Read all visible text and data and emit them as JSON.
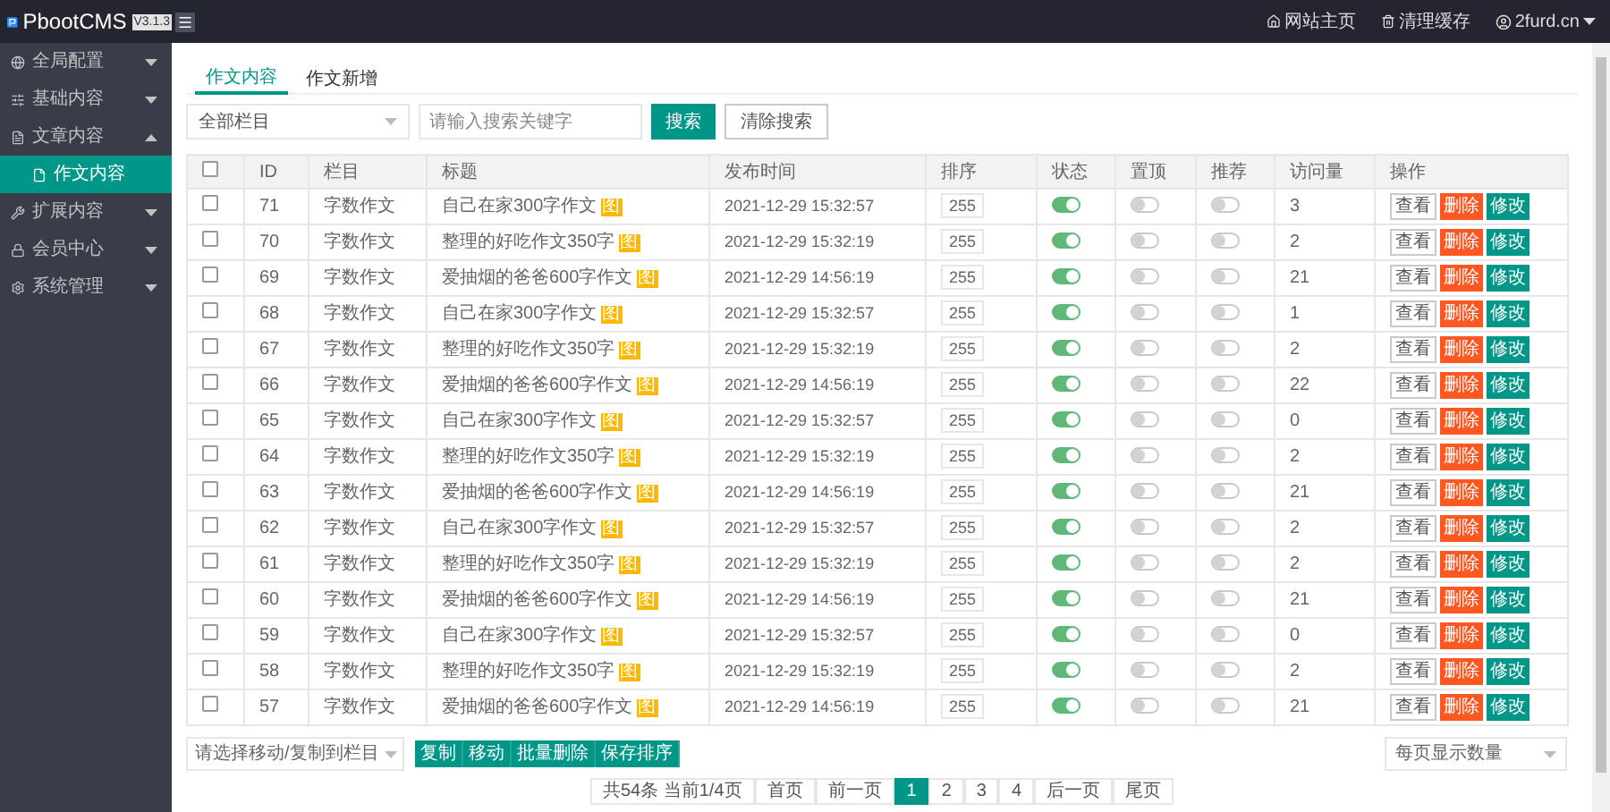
{
  "header": {
    "logo": "PbootCMS",
    "version": "V3.1.3",
    "links": [
      "网站主页",
      "清理缓存"
    ],
    "user": "2furd.cn"
  },
  "sidebar": {
    "items": [
      {
        "label": "全局配置",
        "expanded": false
      },
      {
        "label": "基础内容",
        "expanded": false
      },
      {
        "label": "文章内容",
        "expanded": true,
        "children": [
          {
            "label": "作文内容",
            "selected": true
          }
        ]
      },
      {
        "label": "扩展内容",
        "expanded": false
      },
      {
        "label": "会员中心",
        "expanded": false
      },
      {
        "label": "系统管理",
        "expanded": false
      }
    ]
  },
  "tabs": [
    {
      "label": "作文内容",
      "selected": true
    },
    {
      "label": "作文新增",
      "selected": false
    }
  ],
  "filters": {
    "category": "全部栏目",
    "search_placeholder": "请输入搜索关键字",
    "buttons": [
      {
        "label": "搜索",
        "kind": "primary"
      },
      {
        "label": "清除搜索",
        "kind": "plain"
      }
    ]
  },
  "table": {
    "header_checked": false,
    "columns": [
      "ID",
      "栏目",
      "标题",
      "发布时间",
      "排序",
      "状态",
      "置顶",
      "推荐",
      "访问量",
      "操作"
    ],
    "rows": [
      {
        "checked": false,
        "id": "71",
        "category": "字数作文",
        "title": "自己在家300字作文",
        "badge": "图",
        "time": "2021-12-29 15:32:57",
        "sort": "255",
        "status": true,
        "top": false,
        "recommend": false,
        "visits": "3",
        "actions": [
          {
            "label": "查看",
            "kind": "view"
          },
          {
            "label": "删除",
            "kind": "delete"
          },
          {
            "label": "修改",
            "kind": "edit"
          }
        ]
      },
      {
        "checked": false,
        "id": "70",
        "category": "字数作文",
        "title": "整理的好吃作文350字",
        "badge": "图",
        "time": "2021-12-29 15:32:19",
        "sort": "255",
        "status": true,
        "top": false,
        "recommend": false,
        "visits": "2",
        "actions": [
          {
            "label": "查看",
            "kind": "view"
          },
          {
            "label": "删除",
            "kind": "delete"
          },
          {
            "label": "修改",
            "kind": "edit"
          }
        ]
      },
      {
        "checked": false,
        "id": "69",
        "category": "字数作文",
        "title": "爱抽烟的爸爸600字作文",
        "badge": "图",
        "time": "2021-12-29 14:56:19",
        "sort": "255",
        "status": true,
        "top": false,
        "recommend": false,
        "visits": "21",
        "actions": [
          {
            "label": "查看",
            "kind": "view"
          },
          {
            "label": "删除",
            "kind": "delete"
          },
          {
            "label": "修改",
            "kind": "edit"
          }
        ]
      },
      {
        "checked": false,
        "id": "68",
        "category": "字数作文",
        "title": "自己在家300字作文",
        "badge": "图",
        "time": "2021-12-29 15:32:57",
        "sort": "255",
        "status": true,
        "top": false,
        "recommend": false,
        "visits": "1",
        "actions": [
          {
            "label": "查看",
            "kind": "view"
          },
          {
            "label": "删除",
            "kind": "delete"
          },
          {
            "label": "修改",
            "kind": "edit"
          }
        ]
      },
      {
        "checked": false,
        "id": "67",
        "category": "字数作文",
        "title": "整理的好吃作文350字",
        "badge": "图",
        "time": "2021-12-29 15:32:19",
        "sort": "255",
        "status": true,
        "top": false,
        "recommend": false,
        "visits": "2",
        "actions": [
          {
            "label": "查看",
            "kind": "view"
          },
          {
            "label": "删除",
            "kind": "delete"
          },
          {
            "label": "修改",
            "kind": "edit"
          }
        ]
      },
      {
        "checked": false,
        "id": "66",
        "category": "字数作文",
        "title": "爱抽烟的爸爸600字作文",
        "badge": "图",
        "time": "2021-12-29 14:56:19",
        "sort": "255",
        "status": true,
        "top": false,
        "recommend": false,
        "visits": "22",
        "actions": [
          {
            "label": "查看",
            "kind": "view"
          },
          {
            "label": "删除",
            "kind": "delete"
          },
          {
            "label": "修改",
            "kind": "edit"
          }
        ]
      },
      {
        "checked": false,
        "id": "65",
        "category": "字数作文",
        "title": "自己在家300字作文",
        "badge": "图",
        "time": "2021-12-29 15:32:57",
        "sort": "255",
        "status": true,
        "top": false,
        "recommend": false,
        "visits": "0",
        "actions": [
          {
            "label": "查看",
            "kind": "view"
          },
          {
            "label": "删除",
            "kind": "delete"
          },
          {
            "label": "修改",
            "kind": "edit"
          }
        ]
      },
      {
        "checked": false,
        "id": "64",
        "category": "字数作文",
        "title": "整理的好吃作文350字",
        "badge": "图",
        "time": "2021-12-29 15:32:19",
        "sort": "255",
        "status": true,
        "top": false,
        "recommend": false,
        "visits": "2",
        "actions": [
          {
            "label": "查看",
            "kind": "view"
          },
          {
            "label": "删除",
            "kind": "delete"
          },
          {
            "label": "修改",
            "kind": "edit"
          }
        ]
      },
      {
        "checked": false,
        "id": "63",
        "category": "字数作文",
        "title": "爱抽烟的爸爸600字作文",
        "badge": "图",
        "time": "2021-12-29 14:56:19",
        "sort": "255",
        "status": true,
        "top": false,
        "recommend": false,
        "visits": "21",
        "actions": [
          {
            "label": "查看",
            "kind": "view"
          },
          {
            "label": "删除",
            "kind": "delete"
          },
          {
            "label": "修改",
            "kind": "edit"
          }
        ]
      },
      {
        "checked": false,
        "id": "62",
        "category": "字数作文",
        "title": "自己在家300字作文",
        "badge": "图",
        "time": "2021-12-29 15:32:57",
        "sort": "255",
        "status": true,
        "top": false,
        "recommend": false,
        "visits": "2",
        "actions": [
          {
            "label": "查看",
            "kind": "view"
          },
          {
            "label": "删除",
            "kind": "delete"
          },
          {
            "label": "修改",
            "kind": "edit"
          }
        ]
      },
      {
        "checked": false,
        "id": "61",
        "category": "字数作文",
        "title": "整理的好吃作文350字",
        "badge": "图",
        "time": "2021-12-29 15:32:19",
        "sort": "255",
        "status": true,
        "top": false,
        "recommend": false,
        "visits": "2",
        "actions": [
          {
            "label": "查看",
            "kind": "view"
          },
          {
            "label": "删除",
            "kind": "delete"
          },
          {
            "label": "修改",
            "kind": "edit"
          }
        ]
      },
      {
        "checked": false,
        "id": "60",
        "category": "字数作文",
        "title": "爱抽烟的爸爸600字作文",
        "badge": "图",
        "time": "2021-12-29 14:56:19",
        "sort": "255",
        "status": true,
        "top": false,
        "recommend": false,
        "visits": "21",
        "actions": [
          {
            "label": "查看",
            "kind": "view"
          },
          {
            "label": "删除",
            "kind": "delete"
          },
          {
            "label": "修改",
            "kind": "edit"
          }
        ]
      },
      {
        "checked": false,
        "id": "59",
        "category": "字数作文",
        "title": "自己在家300字作文",
        "badge": "图",
        "time": "2021-12-29 15:32:57",
        "sort": "255",
        "status": true,
        "top": false,
        "recommend": false,
        "visits": "0",
        "actions": [
          {
            "label": "查看",
            "kind": "view"
          },
          {
            "label": "删除",
            "kind": "delete"
          },
          {
            "label": "修改",
            "kind": "edit"
          }
        ]
      },
      {
        "checked": false,
        "id": "58",
        "category": "字数作文",
        "title": "整理的好吃作文350字",
        "badge": "图",
        "time": "2021-12-29 15:32:19",
        "sort": "255",
        "status": true,
        "top": false,
        "recommend": false,
        "visits": "2",
        "actions": [
          {
            "label": "查看",
            "kind": "view"
          },
          {
            "label": "删除",
            "kind": "delete"
          },
          {
            "label": "修改",
            "kind": "edit"
          }
        ]
      },
      {
        "checked": false,
        "id": "57",
        "category": "字数作文",
        "title": "爱抽烟的爸爸600字作文",
        "badge": "图",
        "time": "2021-12-29 14:56:19",
        "sort": "255",
        "status": true,
        "top": false,
        "recommend": false,
        "visits": "21",
        "actions": [
          {
            "label": "查看",
            "kind": "view"
          },
          {
            "label": "删除",
            "kind": "delete"
          },
          {
            "label": "修改",
            "kind": "edit"
          }
        ]
      }
    ]
  },
  "bulk": {
    "target_placeholder": "请选择移动/复制到栏目",
    "buttons": [
      "复制",
      "移动",
      "批量删除",
      "保存排序"
    ]
  },
  "per_page_placeholder": "每页显示数量",
  "pagination": {
    "summary": "共54条 当前1/4页",
    "items": [
      {
        "label": "首页",
        "selected": false
      },
      {
        "label": "前一页",
        "selected": false
      },
      {
        "label": "1",
        "selected": true
      },
      {
        "label": "2",
        "selected": false
      },
      {
        "label": "3",
        "selected": false
      },
      {
        "label": "4",
        "selected": false
      },
      {
        "label": "后一页",
        "selected": false
      },
      {
        "label": "尾页",
        "selected": false
      }
    ]
  }
}
